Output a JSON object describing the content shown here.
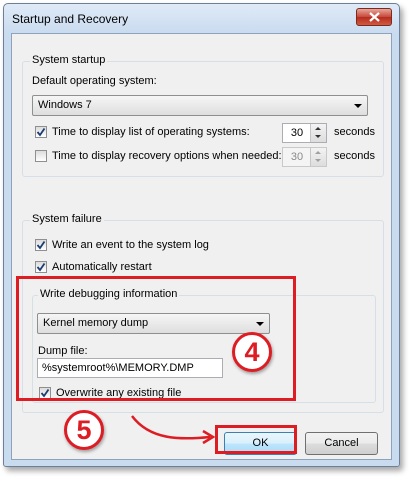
{
  "window": {
    "title": "Startup and Recovery"
  },
  "system_startup": {
    "group_label": "System startup",
    "default_os_label": "Default operating system:",
    "default_os_value": "Windows 7",
    "time_list_label": "Time to display list of operating systems:",
    "time_list_checked": true,
    "time_list_value": "30",
    "time_list_unit": "seconds",
    "time_recovery_label": "Time to display recovery options when needed:",
    "time_recovery_checked": false,
    "time_recovery_value": "30",
    "time_recovery_unit": "seconds"
  },
  "system_failure": {
    "group_label": "System failure",
    "write_event_label": "Write an event to the system log",
    "write_event_checked": true,
    "auto_restart_label": "Automatically restart",
    "auto_restart_checked": true,
    "debug_group_label": "Write debugging information",
    "debug_type_value": "Kernel memory dump",
    "dump_file_label": "Dump file:",
    "dump_file_value": "%systemroot%\\MEMORY.DMP",
    "overwrite_label": "Overwrite any existing file",
    "overwrite_checked": true
  },
  "buttons": {
    "ok": "OK",
    "cancel": "Cancel"
  },
  "annotations": {
    "step4": "4",
    "step5": "5",
    "color": "#dd1c23"
  }
}
